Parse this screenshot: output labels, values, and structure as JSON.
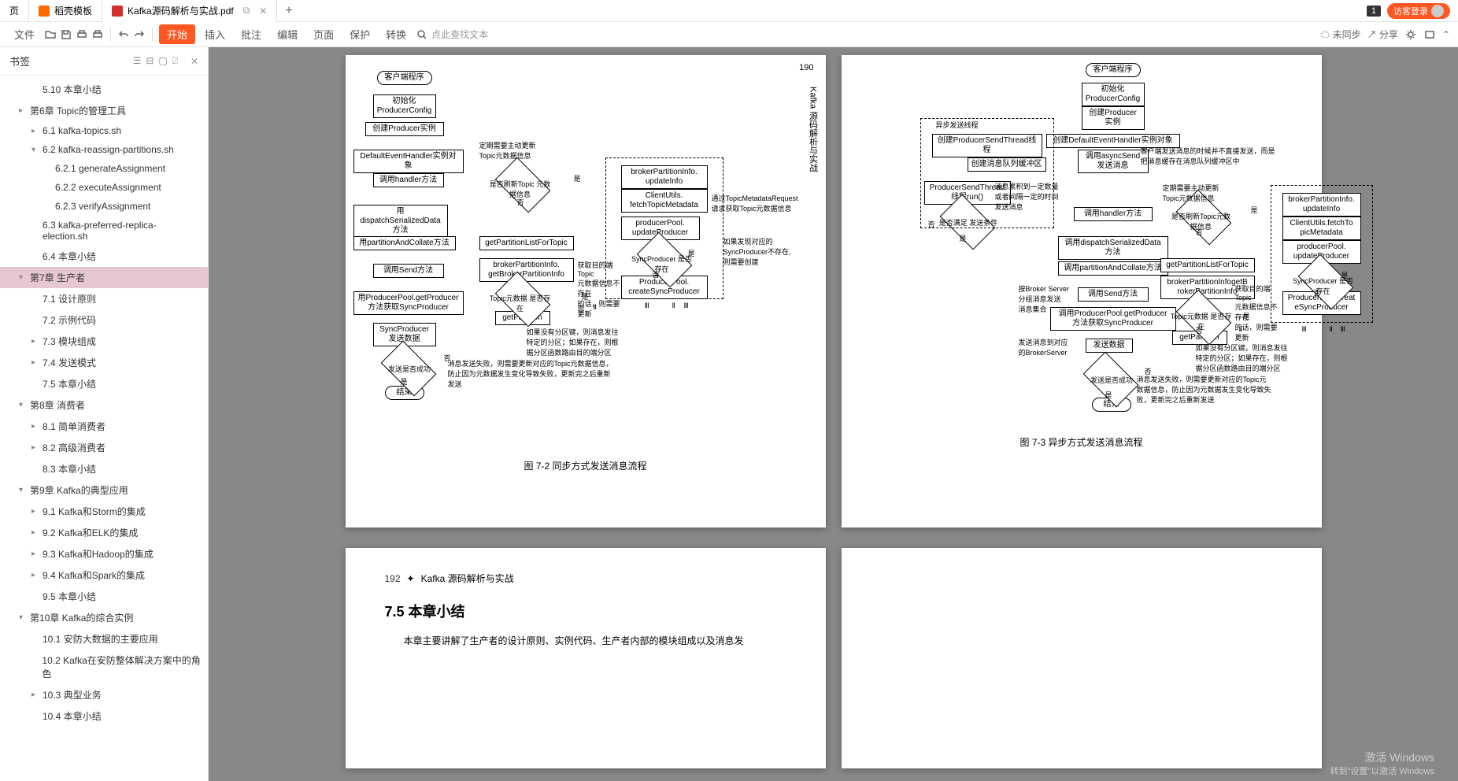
{
  "tabs": {
    "home": "页",
    "docker": "稻壳模板",
    "pdf": "Kafka源码解析与实战.pdf"
  },
  "titlebar": {
    "badge": "1",
    "login": "访客登录"
  },
  "toolbar": {
    "file": "文件",
    "start": "开始",
    "insert": "插入",
    "annotate": "批注",
    "edit": "编辑",
    "page": "页面",
    "protect": "保护",
    "convert": "转换",
    "search_placeholder": "点此查找文本",
    "sync": "未同步",
    "share": "分享"
  },
  "sidebar": {
    "title": "书签",
    "items": [
      {
        "level": 2,
        "label": "5.10 本章小结",
        "toggle": ""
      },
      {
        "level": 1,
        "label": "第6章 Topic的管理工具",
        "toggle": "▸"
      },
      {
        "level": 2,
        "label": "6.1 kafka-topics.sh",
        "toggle": "▸"
      },
      {
        "level": 2,
        "label": "6.2 kafka-reassign-partitions.sh",
        "toggle": "▾"
      },
      {
        "level": 3,
        "label": "6.2.1 generateAssignment",
        "toggle": ""
      },
      {
        "level": 3,
        "label": "6.2.2 executeAssignment",
        "toggle": ""
      },
      {
        "level": 3,
        "label": "6.2.3 verifyAssignment",
        "toggle": ""
      },
      {
        "level": 2,
        "label": "6.3 kafka-preferred-replica-election.sh",
        "toggle": ""
      },
      {
        "level": 2,
        "label": "6.4 本章小结",
        "toggle": ""
      },
      {
        "level": 1,
        "label": "第7章 生产者",
        "toggle": "▾",
        "active": true
      },
      {
        "level": 2,
        "label": "7.1 设计原则",
        "toggle": ""
      },
      {
        "level": 2,
        "label": "7.2 示例代码",
        "toggle": ""
      },
      {
        "level": 2,
        "label": "7.3 模块组成",
        "toggle": "▸"
      },
      {
        "level": 2,
        "label": "7.4 发送模式",
        "toggle": "▸"
      },
      {
        "level": 2,
        "label": "7.5 本章小结",
        "toggle": ""
      },
      {
        "level": 1,
        "label": "第8章 消费者",
        "toggle": "▾"
      },
      {
        "level": 2,
        "label": "8.1 简单消费者",
        "toggle": "▸"
      },
      {
        "level": 2,
        "label": "8.2 高级消费者",
        "toggle": "▸"
      },
      {
        "level": 2,
        "label": "8.3 本章小结",
        "toggle": ""
      },
      {
        "level": 1,
        "label": "第9章 Kafka的典型应用",
        "toggle": "▾"
      },
      {
        "level": 2,
        "label": "9.1 Kafka和Storm的集成",
        "toggle": "▸"
      },
      {
        "level": 2,
        "label": "9.2 Kafka和ELK的集成",
        "toggle": "▸"
      },
      {
        "level": 2,
        "label": "9.3 Kafka和Hadoop的集成",
        "toggle": "▸"
      },
      {
        "level": 2,
        "label": "9.4 Kafka和Spark的集成",
        "toggle": "▸"
      },
      {
        "level": 2,
        "label": "9.5 本章小结",
        "toggle": ""
      },
      {
        "level": 1,
        "label": "第10章 Kafka的综合实例",
        "toggle": "▾"
      },
      {
        "level": 2,
        "label": "10.1 安防大数据的主要应用",
        "toggle": ""
      },
      {
        "level": 2,
        "label": "10.2 Kafka在安防整体解决方案中的角色",
        "toggle": ""
      },
      {
        "level": 2,
        "label": "10.3 典型业务",
        "toggle": "▸"
      },
      {
        "level": 2,
        "label": "10.4 本章小结",
        "toggle": ""
      }
    ]
  },
  "page1": {
    "num": "190",
    "side": "Kafka 源码解析与实战",
    "caption": "图 7-2   同步方式发送消息流程",
    "boxes": {
      "b1": "客户端程序",
      "b2": "初始化\nProducerConfig",
      "b3": "创建Producer实例",
      "b4": "DefaultEventHandler实例对象",
      "b5": "调用handler方法",
      "b6": "用dispatchSerializedData\n方法",
      "b7": "用partitionAndCollate方法",
      "b8": "调用Send方法",
      "b9": "用ProducerPool.getProducer\n方法获取SyncProducer",
      "b10": "SyncProducer\n发送数据",
      "b11": "结束",
      "b12": "getPartitionListForTopic",
      "b13": "brokerPartitionInfo.\ngetBrokerPartitionInfo",
      "b14": "getPartition",
      "b15": "brokerPartitionInfo.\nupdateInfo",
      "b16": "ClientUtils.\nfetchTopicMetadata",
      "b17": "producerPool.\nupdateProducer",
      "b18": "ProducerPool.\ncreateSyncProducer"
    },
    "diamonds": {
      "d1": "是否刷新Topic\n元数据信息",
      "d2": "Topic元数据\n是否存在",
      "d3": "发送是否成功",
      "d4": "SyncProducer\n是否存在"
    },
    "notes": {
      "n1": "定期需要主动更新\nTopic元数据信息",
      "n2": "通过TopicMetadataRequest\n请求获取Topic元数据信息",
      "n3": "如果发现对应的\nSyncProducer不存在,\n则需要创建",
      "n4": "获取目的端Topic\n元数据信息不存在\n的话，则需要更新",
      "n5": "如果没有分区键，则消息发往\n特定的分区；如果存在，则根\n据分区函数路由目的端分区",
      "n6": "消息发送失败，则需要更新对应的Topic元数据信息，\n防止因为元数据发生变化导致失败，更新完之后重新\n发送",
      "n7": "是",
      "n8": "否",
      "n9": "是",
      "n10": "否",
      "n11": "是",
      "n12": "否",
      "n13": "是",
      "n14": "否",
      "n15": "Ⅱ",
      "n16": "Ⅱ",
      "n17": "Ⅲ",
      "n18": "Ⅲ"
    }
  },
  "page2": {
    "caption": "图 7-3   异步方式发送消息流程",
    "boxes": {
      "b1": "客户端程序",
      "b2": "初始化\nProducerConfig",
      "b3": "创建Producer\n实例",
      "b4": "创建DefaultEventHandler实例对象",
      "b5": "创建ProducerSendThread线程",
      "b6": "创建消息队列缓冲区",
      "b7": "ProducerSendThread\n线程run()",
      "b8": "调用asyncSend\n发送消息",
      "b9": "调用handler方法",
      "b10": "调用dispatchSerializedData\n方法",
      "b11": "调用partitionAndCollate方法",
      "b12": "调用Send方法",
      "b13": "调用ProducerPool.getProducer\n方法获取SyncProducer",
      "b14": "发送数据",
      "b15": "结束",
      "b16": "异步发送线程",
      "b17": "brokerPartitionInfo.\nupdateInfo",
      "b18": "ClientUtils.fetchTo\npicMetadata",
      "b19": "producerPool.\nupdateProducer",
      "b20": "getPartitionListForTopic",
      "b21": "brokerPartitionInfogetB\nrokerPartitionInfo",
      "b22": "getPartition",
      "b23": "ProducerPool.creat\neSyncProducer"
    },
    "diamonds": {
      "d1": "是否满足\n发送条件",
      "d2": "是否刷新Topic元数据信息",
      "d3": "Topic元数据\n是否存在",
      "d4": "发送是否成功",
      "d5": "SyncProducer\n是否存在"
    },
    "notes": {
      "n1": "客户端发送消息的时候并不直接发送，而是\n把消息缓存在消息队列缓冲区中",
      "n2": "消息累积到一定数量\n或者间隔一定的时间\n发送消息",
      "n3": "定期需要主动更新\nTopic元数据信息",
      "n4": "按Broker Server\n分组消息发送\n消息集合",
      "n5": "获取目的端Topic\n元数据信息不存在\n的话，则需要更新",
      "n6": "发送消息到对应\n的BrokerServer",
      "n7": "如果没有分区键，则消息发往\n特定的分区；如果存在，则根\n据分区函数路由目的端分区",
      "n8": "消息发送失败，则需要更新对应的Topic元\n数据信息，防止因为元数据发生变化导致失\n败，更新完之后重新发送",
      "n9": "是",
      "n10": "否",
      "n11": "是",
      "n12": "否",
      "n13": "是",
      "n14": "否",
      "n15": "是",
      "n16": "否",
      "n17": "是",
      "n18": "否",
      "n19": "Ⅱ",
      "n20": "Ⅱ",
      "n21": "Ⅲ",
      "n22": "Ⅲ"
    }
  },
  "page3": {
    "num": "192",
    "header": "Kafka 源码解析与实战",
    "title": "7.5   本章小结",
    "body": "本章主要讲解了生产者的设计原则、实例代码、生产者内部的模块组成以及消息发"
  },
  "watermark": {
    "line1": "激活 Windows",
    "line2": "转到\"设置\"以激活 Windows"
  }
}
